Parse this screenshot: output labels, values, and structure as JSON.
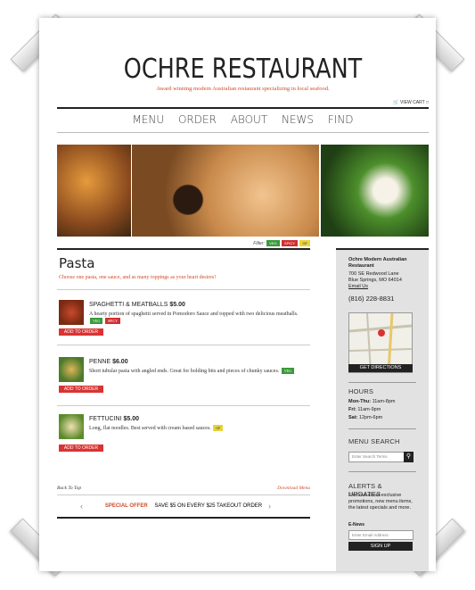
{
  "header": {
    "logo": "OCHRE RESTAURANT",
    "tagline": "Award winning modern Australian restaurant specializing in local seafood.",
    "cart": "VIEW CART"
  },
  "nav": [
    "MENU",
    "ORDER",
    "ABOUT",
    "NEWS",
    "FIND"
  ],
  "filter": {
    "label": "Filter:",
    "tags": [
      "VEG",
      "SPICY",
      "GF"
    ]
  },
  "section": {
    "title": "Pasta",
    "subtitle": "Choose one pasta, one sauce, and as many toppings as your heart desires!"
  },
  "items": [
    {
      "name": "SPAGHETTI & MEATBALLS",
      "price": "$5.00",
      "desc": "A hearty portion of spaghetti served in Pomodoro Sauce and topped with two delicious meatballs.",
      "tags": [
        "VEG",
        "SPICY"
      ],
      "button": "ADD TO ORDER"
    },
    {
      "name": "PENNE",
      "price": "$6.00",
      "desc": "Short tubular pasta with angled ends. Great for holding bits and pieces of chunky sauces.",
      "tags": [
        "VEG"
      ],
      "button": "ADD TO ORDER"
    },
    {
      "name": "FETTUCINI",
      "price": "$5.00",
      "desc": "Long, flat noodles. Best served with cream based sauces.",
      "tags": [
        "GF"
      ],
      "button": "ADD TO ORDER"
    }
  ],
  "bottom": {
    "back_to_top": "Back To Top",
    "download": "Download Menu"
  },
  "offer": {
    "label": "SPECIAL OFFER",
    "text": "SAVE $5 ON EVERY $25 TAKEOUT ORDER"
  },
  "sidebar": {
    "address_name": "Ochre Modern Australian Restaurant",
    "address_line1": "700 SE Redwood Lane",
    "address_line2": "Blue Springs, MO 64014",
    "email_link": "Email Us",
    "phone": "(816) 228-8831",
    "directions": "GET DIRECTIONS",
    "hours_title": "HOURS",
    "hours": [
      {
        "day": "Mon-Thu:",
        "time": "11am-8pm"
      },
      {
        "day": "Fri:",
        "time": "11am-9pm"
      },
      {
        "day": "Sat:",
        "time": "12pm-6pm"
      }
    ],
    "search_title": "MENU SEARCH",
    "search_placeholder": "Enter Search Terms",
    "alerts_title": "ALERTS & UPDATES",
    "alerts_text": "Find out about exclusive promotions, new menu items, the latest specials and more.",
    "enews_label": "E-News",
    "email_placeholder": "Enter Email Address",
    "signup": "SIGN UP"
  }
}
